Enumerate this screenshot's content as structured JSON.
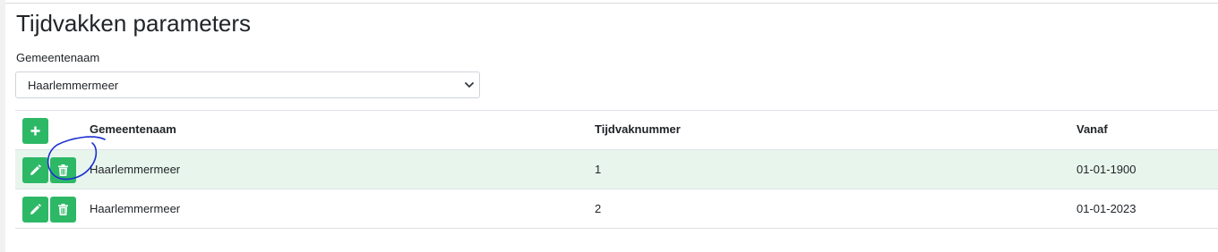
{
  "page": {
    "title": "Tijdvakken parameters"
  },
  "filter": {
    "label": "Gemeentenaam",
    "selected": "Haarlemmermeer"
  },
  "table": {
    "headers": {
      "gemeentenaam": "Gemeentenaam",
      "tijdvaknummer": "Tijdvaknummer",
      "vanaf": "Vanaf"
    },
    "rows": [
      {
        "gemeentenaam": "Haarlemmermeer",
        "tijdvaknummer": "1",
        "vanaf": "01-01-1900"
      },
      {
        "gemeentenaam": "Haarlemmermeer",
        "tijdvaknummer": "2",
        "vanaf": "01-01-2023"
      }
    ]
  },
  "icons": {
    "add": "plus-icon",
    "edit": "pencil-icon",
    "delete": "trash-icon",
    "select": "chevron-down-icon"
  },
  "colors": {
    "button": "#2db866",
    "row_highlight": "#e8f5ec",
    "annotation": "#1a2fd0"
  }
}
